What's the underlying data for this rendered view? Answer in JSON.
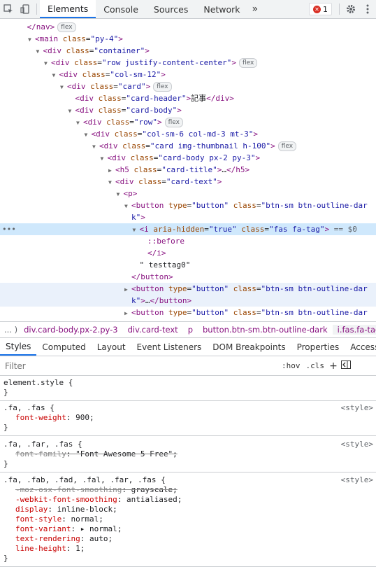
{
  "toolbar": {
    "tabs": [
      "Elements",
      "Console",
      "Sources",
      "Network"
    ],
    "more": "»",
    "error_count": "1"
  },
  "tree": {
    "lines": [
      {
        "indent": 3,
        "tri": "",
        "html": "</nav>",
        "badge": "flex"
      },
      {
        "indent": 4,
        "tri": "▼",
        "open": "<main",
        "attrs": [
          [
            "class",
            "py-4"
          ]
        ],
        "close": ">"
      },
      {
        "indent": 5,
        "tri": "▼",
        "open": "<div",
        "attrs": [
          [
            "class",
            "container"
          ]
        ],
        "close": ">"
      },
      {
        "indent": 6,
        "tri": "▼",
        "open": "<div",
        "attrs": [
          [
            "class",
            "row justify-content-center"
          ]
        ],
        "close": ">",
        "badge": "flex"
      },
      {
        "indent": 7,
        "tri": "▼",
        "open": "<div",
        "attrs": [
          [
            "class",
            "col-sm-12"
          ]
        ],
        "close": ">"
      },
      {
        "indent": 8,
        "tri": "▼",
        "open": "<div",
        "attrs": [
          [
            "class",
            "card"
          ]
        ],
        "close": ">",
        "badge": "flex"
      },
      {
        "indent": 9,
        "tri": "",
        "open": "<div",
        "attrs": [
          [
            "class",
            "card-header"
          ]
        ],
        "close": ">",
        "text": "記事",
        "end": "</div>"
      },
      {
        "indent": 9,
        "tri": "▼",
        "open": "<div",
        "attrs": [
          [
            "class",
            "card-body"
          ]
        ],
        "close": ">"
      },
      {
        "indent": 10,
        "tri": "▼",
        "open": "<div",
        "attrs": [
          [
            "class",
            "row"
          ]
        ],
        "close": ">",
        "badge": "flex"
      },
      {
        "indent": 11,
        "tri": "▼",
        "open": "<div",
        "attrs": [
          [
            "class",
            "col-sm-6 col-md-3  mt-3"
          ]
        ],
        "close": ">"
      },
      {
        "indent": 12,
        "tri": "▼",
        "open": "<div",
        "attrs": [
          [
            "class",
            "card img-thumbnail h-100"
          ]
        ],
        "close": ">",
        "badge": "flex"
      },
      {
        "indent": 13,
        "tri": "▼",
        "open": "<div",
        "attrs": [
          [
            "class",
            "card-body px-2 py-3"
          ]
        ],
        "close": ">"
      },
      {
        "indent": 14,
        "tri": "▶",
        "open": "<h5",
        "attrs": [
          [
            "class",
            "card-title"
          ]
        ],
        "close": ">",
        "text": "…",
        "end": "</h5>"
      },
      {
        "indent": 14,
        "tri": "▼",
        "open": "<div",
        "attrs": [
          [
            "class",
            "card-text"
          ]
        ],
        "close": ">"
      },
      {
        "indent": 15,
        "tri": "▼",
        "open": "<p",
        "attrs": [],
        "close": ">"
      },
      {
        "indent": 16,
        "tri": "▼",
        "open": "<button",
        "attrs": [
          [
            "type",
            "button"
          ],
          [
            "class",
            "btn-sm btn-outline-dar"
          ]
        ],
        "close": ""
      },
      {
        "indent": 16,
        "tri": "",
        "cont": "k\">",
        "contOnly": true
      },
      {
        "indent": 17,
        "tri": "▼",
        "open": "<i",
        "attrs": [
          [
            "aria-hidden",
            "true"
          ],
          [
            "class",
            "fas fa-tag"
          ]
        ],
        "close": ">",
        "eq": " == $0",
        "selected": true,
        "dots": "•••"
      },
      {
        "indent": 18,
        "tri": "",
        "pseudo": "::before"
      },
      {
        "indent": 18,
        "tri": "",
        "html": "</i>"
      },
      {
        "indent": 17,
        "tri": "",
        "plain": "\" testtag0\""
      },
      {
        "indent": 16,
        "tri": "",
        "html": "</button>"
      },
      {
        "indent": 16,
        "tri": "▶",
        "open": "<button",
        "attrs": [
          [
            "type",
            "button"
          ],
          [
            "class",
            "btn-sm btn-outline-dar"
          ]
        ],
        "close": "",
        "hover": true
      },
      {
        "indent": 16,
        "tri": "",
        "cont": "k\">…</button>",
        "contOnly": true,
        "hover": true,
        "contTail": true
      },
      {
        "indent": 16,
        "tri": "▶",
        "open": "<button",
        "attrs": [
          [
            "type",
            "button"
          ],
          [
            "class",
            "btn-sm btn-outline-dar"
          ]
        ],
        "close": ""
      }
    ]
  },
  "breadcrumbs": {
    "lead": "... )",
    "items": [
      "div.card-body.px-2.py-3",
      "div.card-text",
      "p",
      "button.btn-sm.btn-outline-dark",
      "i.fas.fa-tag"
    ]
  },
  "styles_tabs": [
    "Styles",
    "Computed",
    "Layout",
    "Event Listeners",
    "DOM Breakpoints",
    "Properties",
    "Accessibility"
  ],
  "filter": {
    "placeholder": "Filter",
    "hov": ":hov",
    "cls": ".cls",
    "plus": "+"
  },
  "rules": [
    {
      "selector": "element.style {",
      "source": "",
      "props": [],
      "close": "}"
    },
    {
      "selector": ".fa, .fas {",
      "source": "<style>",
      "props": [
        {
          "name": "font-weight",
          "value": "900;",
          "strike": false
        }
      ],
      "close": "}"
    },
    {
      "selector": ".fa, .far, .fas {",
      "source": "<style>",
      "props": [
        {
          "name": "font-family",
          "value": "\"Font Awesome 5 Free\";",
          "strike": true
        }
      ],
      "close": "}"
    },
    {
      "selector": ".fa, .fab, .fad, .fal, .far, .fas {",
      "source": "<style>",
      "props": [
        {
          "name": "-moz-osx-font-smoothing",
          "value": "grayscale;",
          "strike": true
        },
        {
          "name": "-webkit-font-smoothing",
          "value": "antialiased;",
          "strike": false
        },
        {
          "name": "display",
          "value": "inline-block;",
          "strike": false
        },
        {
          "name": "font-style",
          "value": "normal;",
          "strike": false
        },
        {
          "name": "font-variant",
          "value": "▸ normal;",
          "strike": false
        },
        {
          "name": "text-rendering",
          "value": "auto;",
          "strike": false
        },
        {
          "name": "line-height",
          "value": "1;",
          "strike": false
        }
      ],
      "close": "}"
    }
  ]
}
